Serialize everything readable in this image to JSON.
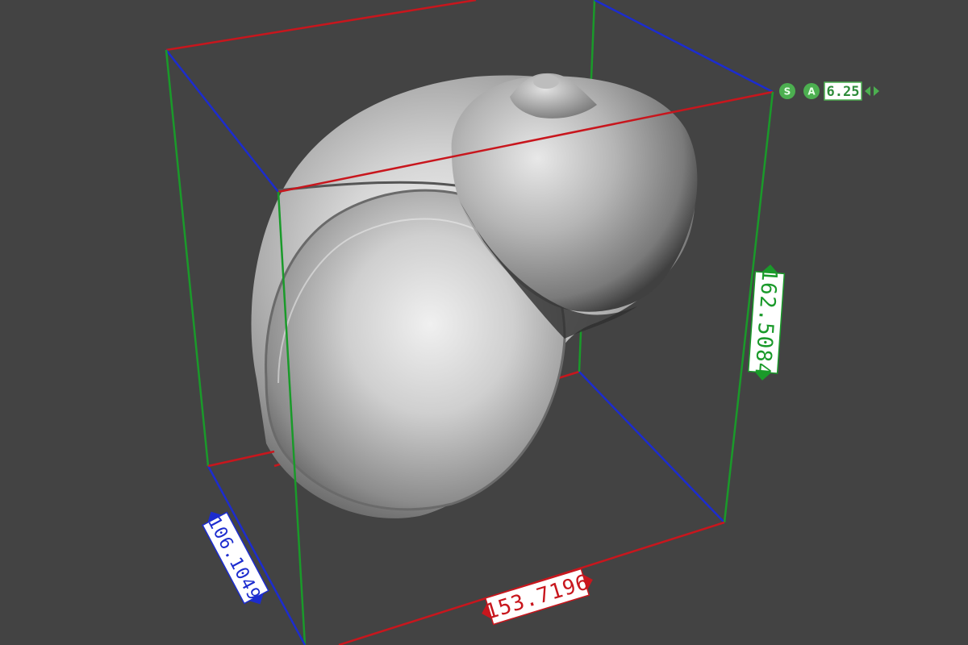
{
  "viewport": {
    "background": "#434343",
    "hud": {
      "snap_label": "S",
      "angle_label": "A",
      "step_value": "6.25",
      "accent": "#4caf50"
    },
    "bounding_box": {
      "width_axis": {
        "value": "153.7196",
        "color": "#c8161d"
      },
      "depth_axis": {
        "value": "106.1049",
        "color": "#1c2ccf"
      },
      "height_axis": {
        "value": "162.5084",
        "color": "#1a9a2a"
      }
    },
    "model": {
      "shape": "snail-shell",
      "color": "#b8b8b8"
    }
  }
}
